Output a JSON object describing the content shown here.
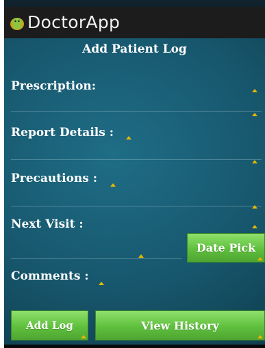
{
  "app": {
    "title": "DoctorApp",
    "icon": "android-icon"
  },
  "screen": {
    "title": "Add Patient Log"
  },
  "fields": {
    "prescription_label": "Prescription:",
    "report_details_label": "Report Details :",
    "precautions_label": "Precautions :",
    "next_visit_label": "Next Visit :",
    "comments_label": "Comments :"
  },
  "buttons": {
    "date_pick": "Date Pick",
    "add_log": "Add Log",
    "view_history": "View History"
  },
  "colors": {
    "actionbar": "#1c1c1c",
    "screen_bg": "#17576d",
    "button_green": "#5fc03d",
    "text": "#ffffff"
  }
}
